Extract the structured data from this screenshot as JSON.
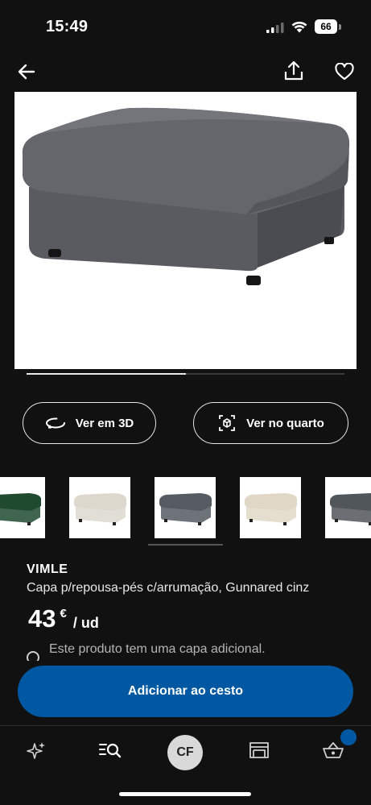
{
  "status_bar": {
    "time": "15:49",
    "battery": "66"
  },
  "nav": {
    "back_icon": "arrow-left-icon",
    "share_icon": "share-icon",
    "favorite_icon": "heart-icon"
  },
  "gallery": {
    "image_count": 2,
    "current_index": 1,
    "progress": 0.5
  },
  "actions": {
    "view_3d_label": "Ver em 3D",
    "view_room_label": "Ver no quarto"
  },
  "swatches": [
    {
      "name": "green",
      "color": "#1f4a30"
    },
    {
      "name": "beige",
      "color": "#dcd8ce"
    },
    {
      "name": "grey",
      "color": "#555a63",
      "selected": true
    },
    {
      "name": "light-beige",
      "color": "#e0d7c6"
    },
    {
      "name": "dark-grey",
      "color": "#51565b"
    }
  ],
  "product": {
    "name": "VIMLE",
    "description": "Capa p/repousa-pés c/arrumação, Gunnared cinz",
    "price_integer": "43",
    "price_currency": "€",
    "price_unit": "/ ud",
    "note": "Este produto tem uma capa adicional."
  },
  "cta": {
    "label": "Adicionar ao cesto",
    "color": "#0058a3"
  },
  "tab_bar": {
    "account_initials": "CF"
  }
}
